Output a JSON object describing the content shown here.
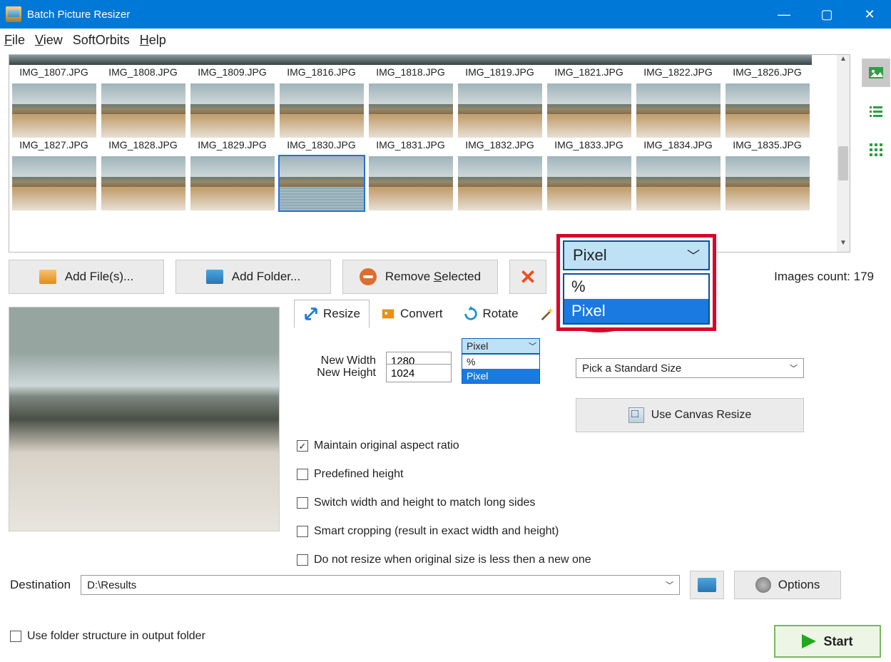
{
  "app": {
    "title": "Batch Picture Resizer"
  },
  "menu": {
    "file": "File",
    "view": "View",
    "softorbits": "SoftOrbits",
    "help": "Help"
  },
  "thumbs_row1": [
    "IMG_1807.JPG",
    "IMG_1808.JPG",
    "IMG_1809.JPG",
    "IMG_1816.JPG",
    "IMG_1818.JPG",
    "IMG_1819.JPG",
    "IMG_1821.JPG",
    "IMG_1822.JPG",
    "IMG_1826.JPG"
  ],
  "thumbs_row2": [
    "IMG_1827.JPG",
    "IMG_1828.JPG",
    "IMG_1829.JPG",
    "IMG_1830.JPG",
    "IMG_1831.JPG",
    "IMG_1832.JPG",
    "IMG_1833.JPG",
    "IMG_1834.JPG",
    "IMG_1835.JPG"
  ],
  "selected_index": 3,
  "toolbar": {
    "add_files": "Add File(s)...",
    "add_folder": "Add Folder...",
    "remove_selected": "Remove Selected"
  },
  "count_label": "Images count: 179",
  "tabs": {
    "resize": "Resize",
    "convert": "Convert",
    "rotate": "Rotate",
    "effects": "Effects"
  },
  "resize": {
    "width_label": "New Width",
    "width_value": "1280",
    "height_label": "New Height",
    "height_value": "1024",
    "unit_selected": "Pixel",
    "unit_options": [
      "%",
      "Pixel"
    ],
    "std_size": "Pick a Standard Size",
    "canvas_btn": "Use Canvas Resize",
    "chk_aspect": "Maintain original aspect ratio",
    "chk_predef": "Predefined height",
    "chk_switch": "Switch width and height to match long sides",
    "chk_smart": "Smart cropping (result in exact width and height)",
    "chk_noresize": "Do not resize when original size is less then a new one"
  },
  "dest": {
    "label": "Destination",
    "value": "D:\\Results"
  },
  "use_folder_structure": "Use folder structure in output folder",
  "buttons": {
    "options": "Options",
    "start": "Start"
  },
  "overlay": {
    "selected": "Pixel",
    "opt1": "%",
    "opt2": "Pixel"
  }
}
